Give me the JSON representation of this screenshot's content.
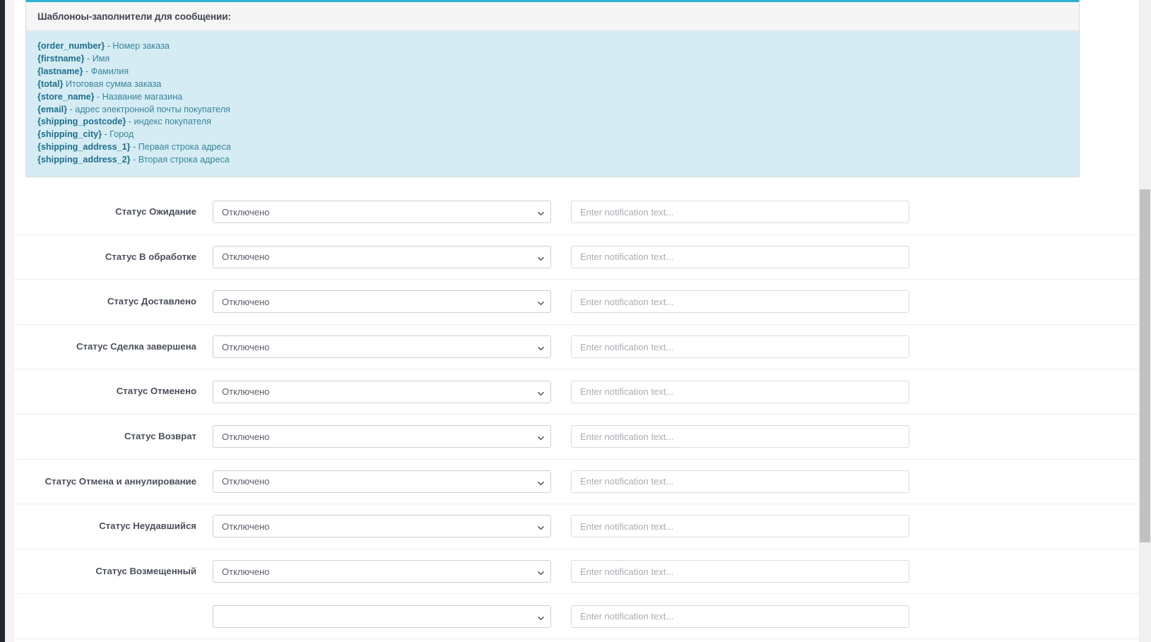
{
  "info_panel": {
    "title": "Шаблоноы-заполнители для сообщении:",
    "accent_color": "#2eb0d6",
    "body_bg": "#d5ecf4",
    "placeholders": [
      {
        "key": "{order_number}",
        "desc": " - Номер заказа"
      },
      {
        "key": "{firstname}",
        "desc": " - Имя"
      },
      {
        "key": "{lastname}",
        "desc": " - Фамилия"
      },
      {
        "key": "{total}",
        "desc": " Итоговая сумма заказа"
      },
      {
        "key": "{store_name}",
        "desc": " - Название магазина"
      },
      {
        "key": "{email}",
        "desc": " - адрес электронной почты покупателя"
      },
      {
        "key": "{shipping_postcode}",
        "desc": " - индекс покупателя"
      },
      {
        "key": "{shipping_city}",
        "desc": " - Город"
      },
      {
        "key": "{shipping_address_1}",
        "desc": " - Первая строка адреса"
      },
      {
        "key": "{shipping_address_2}",
        "desc": " - Вторая строка адреса"
      }
    ]
  },
  "form": {
    "select_value": "Отключено",
    "input_placeholder": "Enter notification text...",
    "input_value": "",
    "rows": [
      {
        "label": "Статус Ожидание",
        "select_value": "Отключено",
        "input_placeholder": "Enter notification text..."
      },
      {
        "label": "Статус В обработке",
        "select_value": "Отключено",
        "input_placeholder": "Enter notification text..."
      },
      {
        "label": "Статус Доставлено",
        "select_value": "Отключено",
        "input_placeholder": "Enter notification text..."
      },
      {
        "label": "Статус Сделка завершена",
        "select_value": "Отключено",
        "input_placeholder": "Enter notification text..."
      },
      {
        "label": "Статус Отменено",
        "select_value": "Отключено",
        "input_placeholder": "Enter notification text..."
      },
      {
        "label": "Статус Возврат",
        "select_value": "Отключено",
        "input_placeholder": "Enter notification text..."
      },
      {
        "label": "Статус Отмена и аннулирование",
        "select_value": "Отключено",
        "input_placeholder": "Enter notification text..."
      },
      {
        "label": "Статус Неудавшийся",
        "select_value": "Отключено",
        "input_placeholder": "Enter notification text..."
      },
      {
        "label": "Статус Возмещенный",
        "select_value": "Отключено",
        "input_placeholder": "Enter notification text..."
      },
      {
        "label": "",
        "select_value": "",
        "input_placeholder": "Enter notification text..."
      }
    ]
  },
  "scrollbar": {
    "track_color": "#f1f1f1",
    "thumb_color": "#c1c1c1"
  }
}
